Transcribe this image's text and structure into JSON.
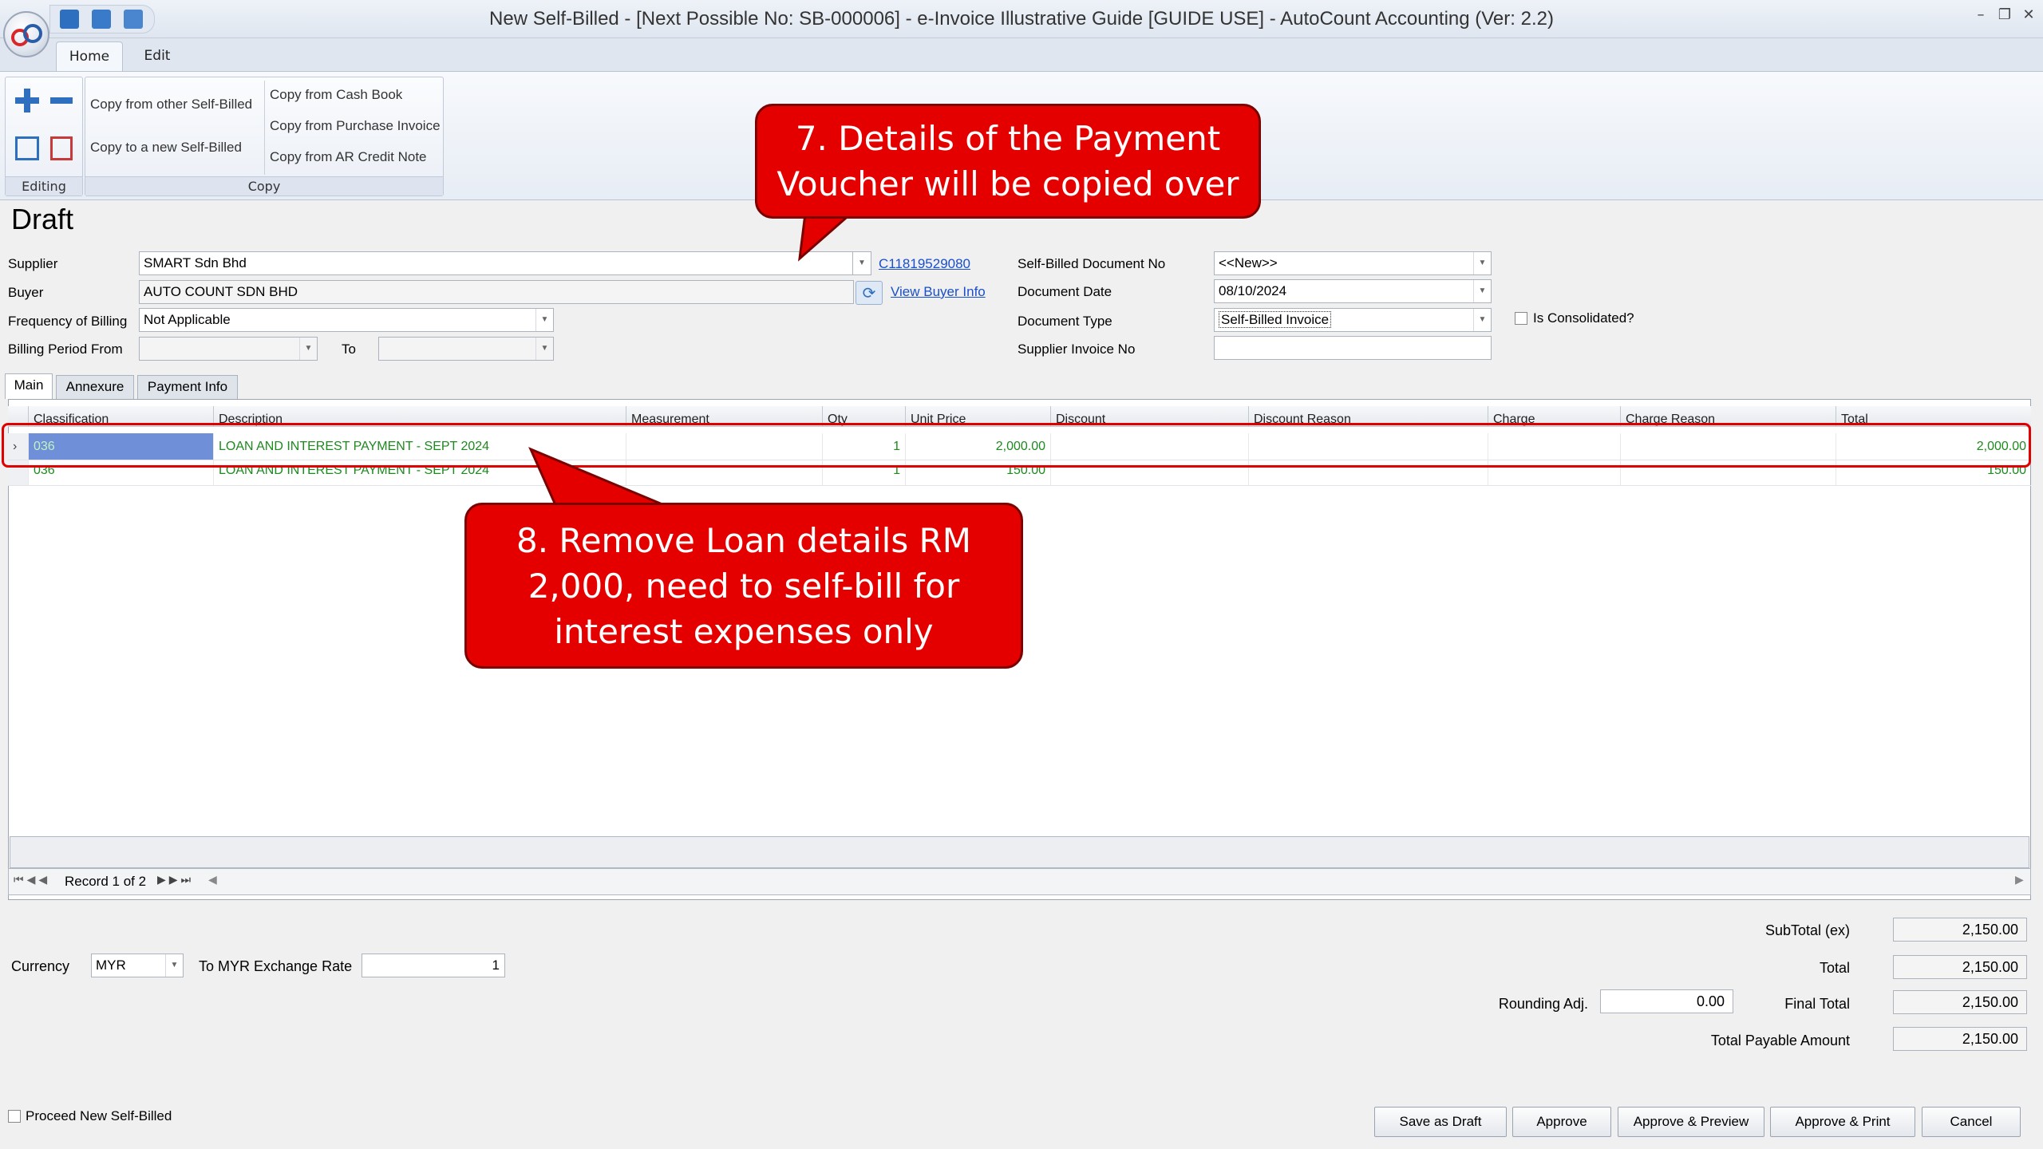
{
  "window": {
    "title": "New Self-Billed - [Next Possible No: SB-000006] - e-Invoice Illustrative Guide [GUIDE USE] - AutoCount Accounting (Ver: 2.2)",
    "controls": [
      "–",
      "❐",
      "✕"
    ]
  },
  "ribbon": {
    "tabs": [
      "Home",
      "Edit"
    ],
    "groups": {
      "editing_label": "Editing",
      "copy_label": "Copy",
      "copy_items": [
        "Copy from other Self-Billed",
        "Copy to a new Self-Billed",
        "Copy from Cash Book",
        "Copy from Purchase Invoice",
        "Copy from AR Credit Note"
      ]
    }
  },
  "form": {
    "status": "Draft",
    "supplier_label": "Supplier",
    "supplier_value": "SMART Sdn Bhd",
    "supplier_code": "C11819529080",
    "buyer_label": "Buyer",
    "buyer_value": "AUTO COUNT SDN BHD",
    "view_buyer_info": "View Buyer Info",
    "frequency_label": "Frequency of Billing",
    "frequency_value": "Not Applicable",
    "billing_from_label": "Billing Period From",
    "billing_to_label": "To",
    "doc_no_label": "Self-Billed Document No",
    "doc_no_value": "<<New>>",
    "doc_date_label": "Document Date",
    "doc_date_value": "08/10/2024",
    "doc_type_label": "Document Type",
    "doc_type_value": "Self-Billed Invoice",
    "consolidated_label": "Is Consolidated?",
    "supplier_invoice_label": "Supplier Invoice No",
    "supplier_invoice_value": ""
  },
  "detail_tabs": [
    "Main",
    "Annexure",
    "Payment Info"
  ],
  "grid": {
    "columns": [
      "Classification",
      "Description",
      "Measurement",
      "Qty",
      "Unit Price",
      "Discount",
      "Discount Reason",
      "Charge",
      "Charge Reason",
      "Total"
    ],
    "rows": [
      {
        "classification": "036",
        "description": "LOAN AND INTEREST PAYMENT - SEPT 2024",
        "measurement": "",
        "qty": "1",
        "unit_price": "2,000.00",
        "discount": "",
        "discount_reason": "",
        "charge": "",
        "charge_reason": "",
        "total": "2,000.00"
      },
      {
        "classification": "036",
        "description": "LOAN AND INTEREST PAYMENT - SEPT 2024",
        "measurement": "",
        "qty": "1",
        "unit_price": "150.00",
        "discount": "",
        "discount_reason": "",
        "charge": "",
        "charge_reason": "",
        "total": "150.00"
      }
    ],
    "record_text": "Record 1 of 2"
  },
  "currency": {
    "label": "Currency",
    "value": "MYR",
    "rate_label": "To MYR Exchange Rate",
    "rate_value": "1"
  },
  "totals": {
    "subtotal_label": "SubTotal (ex)",
    "subtotal_value": "2,150.00",
    "total_label": "Total",
    "total_value": "2,150.00",
    "rounding_label": "Rounding Adj.",
    "rounding_value": "0.00",
    "final_label": "Final Total",
    "final_value": "2,150.00",
    "payable_label": "Total Payable Amount",
    "payable_value": "2,150.00"
  },
  "footer": {
    "proceed_label": "Proceed New Self-Billed",
    "buttons": [
      "Save as Draft",
      "Approve",
      "Approve & Preview",
      "Approve & Print",
      "Cancel"
    ]
  },
  "callouts": {
    "step7": "7. Details of the Payment Voucher will be copied over",
    "step8": "8. Remove Loan details RM 2,000, need to self-bill for interest expenses only"
  },
  "colors": {
    "callout_red": "#e50000",
    "grid_text_green": "#1d8a1d",
    "link_blue": "#1a4fcc",
    "selected_cell": "#6f8fd8"
  }
}
